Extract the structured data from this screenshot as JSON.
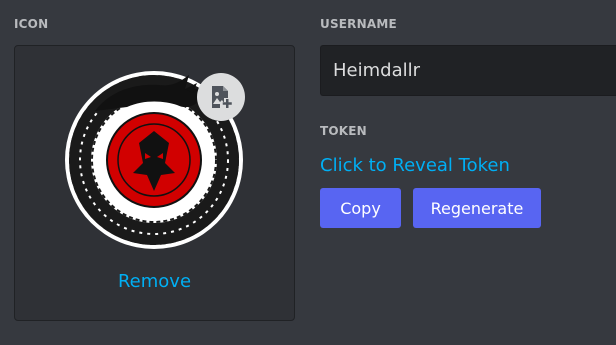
{
  "icon_section": {
    "label": "ICON",
    "remove_label": "Remove"
  },
  "username_section": {
    "label": "USERNAME",
    "value": "Heimdallr"
  },
  "token_section": {
    "label": "TOKEN",
    "reveal_label": "Click to Reveal Token",
    "copy_label": "Copy",
    "regenerate_label": "Regenerate"
  },
  "colors": {
    "background": "#36393f",
    "panel": "#2f3136",
    "input": "#202225",
    "link": "#00aff4",
    "brand_button": "#5865f2"
  },
  "icons": {
    "avatar": "ouroboros-dragon-emblem",
    "upload": "add-image-icon"
  }
}
